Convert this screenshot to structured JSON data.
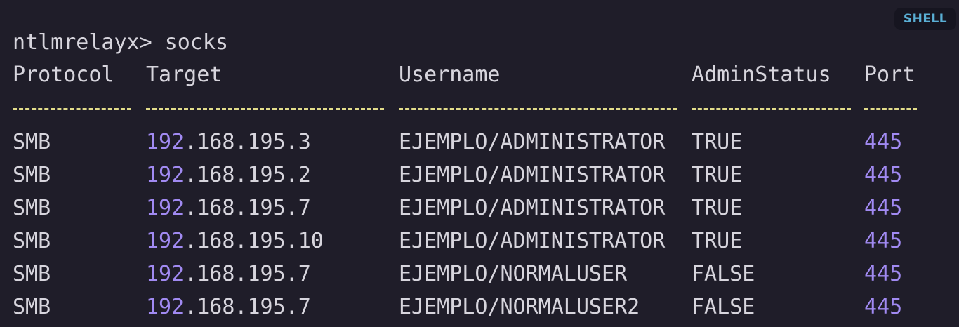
{
  "badge": {
    "label": "SHELL"
  },
  "prompt": {
    "text": "ntlmrelayx> socks"
  },
  "colors": {
    "background": "#1f1d29",
    "text": "#d7d5dd",
    "accent_number": "#a18af2",
    "divider": "#e2dc8a",
    "badge_text": "#5ab0d6"
  },
  "table": {
    "headers": {
      "protocol": "Protocol",
      "target": "Target",
      "username": "Username",
      "admin_status": "AdminStatus",
      "port": "Port"
    },
    "dividers": {
      "protocol": "---------",
      "target": "------------------",
      "username": "---------------------",
      "admin_status": "------------",
      "port": "----"
    },
    "rows": [
      {
        "protocol": "SMB",
        "target_prefix": "192",
        "target_rest": ".168.195.3",
        "username": "EJEMPLO/ADMINISTRATOR",
        "admin_status": "TRUE",
        "port": "445"
      },
      {
        "protocol": "SMB",
        "target_prefix": "192",
        "target_rest": ".168.195.2",
        "username": "EJEMPLO/ADMINISTRATOR",
        "admin_status": "TRUE",
        "port": "445"
      },
      {
        "protocol": "SMB",
        "target_prefix": "192",
        "target_rest": ".168.195.7",
        "username": "EJEMPLO/ADMINISTRATOR",
        "admin_status": "TRUE",
        "port": "445"
      },
      {
        "protocol": "SMB",
        "target_prefix": "192",
        "target_rest": ".168.195.10",
        "username": "EJEMPLO/ADMINISTRATOR",
        "admin_status": "TRUE",
        "port": "445"
      },
      {
        "protocol": "SMB",
        "target_prefix": "192",
        "target_rest": ".168.195.7",
        "username": "EJEMPLO/NORMALUSER",
        "admin_status": "FALSE",
        "port": "445"
      },
      {
        "protocol": "SMB",
        "target_prefix": "192",
        "target_rest": ".168.195.7",
        "username": "EJEMPLO/NORMALUSER2",
        "admin_status": "FALSE",
        "port": "445"
      }
    ]
  }
}
